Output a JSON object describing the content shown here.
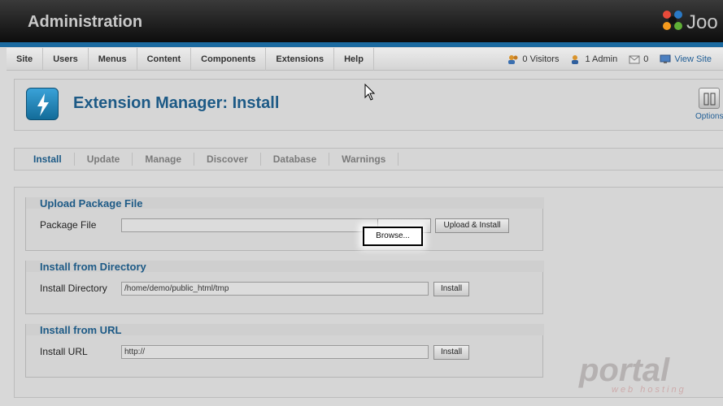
{
  "header": {
    "title": "Administration",
    "brand_text": "Joo"
  },
  "menu": [
    {
      "label": "Site"
    },
    {
      "label": "Users"
    },
    {
      "label": "Menus"
    },
    {
      "label": "Content"
    },
    {
      "label": "Components"
    },
    {
      "label": "Extensions"
    },
    {
      "label": "Help"
    }
  ],
  "status": {
    "visitors": "0 Visitors",
    "admins": "1 Admin",
    "messages": "0",
    "view_site": "View Site"
  },
  "page": {
    "title": "Extension Manager: Install",
    "options_label": "Options"
  },
  "tabs": [
    {
      "label": "Install",
      "active": true
    },
    {
      "label": "Update"
    },
    {
      "label": "Manage"
    },
    {
      "label": "Discover"
    },
    {
      "label": "Database"
    },
    {
      "label": "Warnings"
    }
  ],
  "upload": {
    "legend": "Upload Package File",
    "label": "Package File",
    "value": "",
    "browse_label": "Browse...",
    "button_label": "Upload & Install"
  },
  "directory": {
    "legend": "Install from Directory",
    "label": "Install Directory",
    "value": "/home/demo/public_html/tmp",
    "button_label": "Install"
  },
  "url": {
    "legend": "Install from URL",
    "label": "Install URL",
    "value": "http://",
    "button_label": "Install"
  },
  "watermark": {
    "main": "portal",
    "sub": "web hosting"
  },
  "colors": {
    "accent": "#1d5a86",
    "header_bar": "#1b6aa0"
  }
}
